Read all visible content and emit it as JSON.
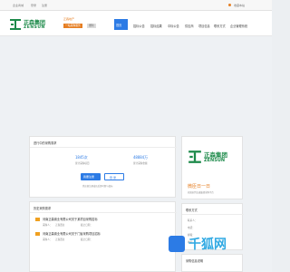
{
  "topbar": {
    "links_left": [
      "企业商城",
      "登录",
      "注册"
    ],
    "links_right": [
      "收藏本站"
    ]
  },
  "logo": {
    "cn": "正森集团",
    "en": "ZENSUN",
    "sub": "正森地产",
    "badge1": "一站采购服务",
    "badge2": "便利"
  },
  "nav": [
    "首页",
    "招标公告",
    "招标结果",
    "中标公告",
    "供应商",
    "项目信息",
    "联系方式",
    "企业管理系统"
  ],
  "left_panel": {
    "title": "进行中的采购需求",
    "stats": [
      {
        "value": "1845次",
        "label": "累计采购项目"
      },
      {
        "value": "48884万",
        "label": "累计采购金额"
      }
    ],
    "btn_primary": "我要注册",
    "btn_secondary": "登 录",
    "footnote": "供应商注册成功后即可参与投标"
  },
  "history_panel": {
    "title": "历史采购需求",
    "items": [
      {
        "title": "河南正森置业有限公司关于某项目采购招标",
        "meta1": "采购人：",
        "meta2": "正森置业",
        "meta3": "截止日期："
      },
      {
        "title": "河南正森置业有限公司关于门窗采购项目招标",
        "meta1": "采购人：",
        "meta2": "正森置业",
        "meta3": "截止日期："
      }
    ]
  },
  "right_panel": {
    "brand_caption": "广告一一广告电动自行车辆",
    "slogan": "微臣日一日",
    "slogan_sub": "欢迎来到正森集团采购平台",
    "contact_title": "联系方式",
    "contact_lines": [
      "联系人：",
      "电话：",
      "邮箱：",
      "地址："
    ],
    "other_title": "采购信息说明"
  },
  "watermark": "千狐网"
}
